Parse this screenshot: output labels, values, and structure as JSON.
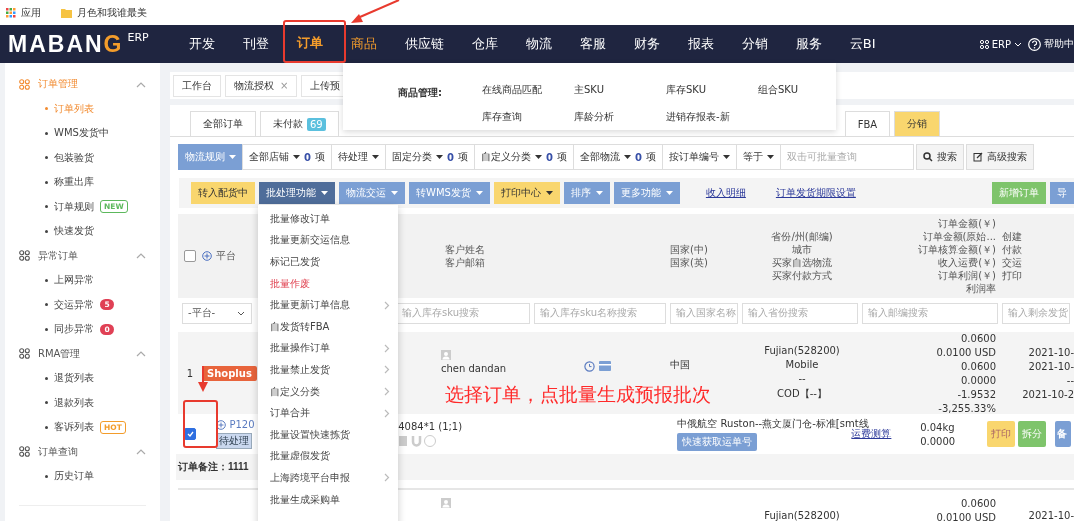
{
  "bookmarks": [
    {
      "kind": "apps",
      "label": "应用"
    },
    {
      "kind": "folder",
      "label": "月色和我谁最美"
    }
  ],
  "nav": {
    "logo": "MABANG",
    "logo_suffix": "ERP",
    "items": [
      {
        "label": "开发",
        "selected": false,
        "open": false
      },
      {
        "label": "刊登",
        "selected": false,
        "open": false
      },
      {
        "label": "订单",
        "selected": true,
        "open": false
      },
      {
        "label": "商品",
        "selected": false,
        "open": true
      },
      {
        "label": "供应链",
        "selected": false,
        "open": false
      },
      {
        "label": "仓库",
        "selected": false,
        "open": false
      },
      {
        "label": "物流",
        "selected": false,
        "open": false
      },
      {
        "label": "客服",
        "selected": false,
        "open": false
      },
      {
        "label": "财务",
        "selected": false,
        "open": false
      },
      {
        "label": "报表",
        "selected": false,
        "open": false
      },
      {
        "label": "分销",
        "selected": false,
        "open": false
      },
      {
        "label": "服务",
        "selected": false,
        "open": false
      },
      {
        "label": "云BI",
        "selected": false,
        "open": false
      }
    ],
    "erp": "ERP",
    "help": "帮助中"
  },
  "sidebar": {
    "groups": [
      {
        "label": "订单管理",
        "selected": true,
        "expanded": true,
        "children": [
          {
            "label": "订单列表",
            "selected": true
          },
          {
            "label": "WMS发货中",
            "selected": false
          },
          {
            "label": "包装验货",
            "selected": false
          },
          {
            "label": "称重出库",
            "selected": false
          },
          {
            "label": "订单规则",
            "selected": false,
            "badge": {
              "kind": "new",
              "text": "NEW"
            }
          },
          {
            "label": "快速发货",
            "selected": false
          }
        ]
      },
      {
        "label": "异常订单",
        "selected": false,
        "expanded": true,
        "children": [
          {
            "label": "上网异常",
            "selected": false
          },
          {
            "label": "交运异常",
            "selected": false,
            "badge": {
              "kind": "count",
              "text": "5"
            }
          },
          {
            "label": "同步异常",
            "selected": false,
            "badge": {
              "kind": "count",
              "text": "0"
            }
          }
        ]
      },
      {
        "label": "RMA管理",
        "selected": false,
        "expanded": true,
        "children": [
          {
            "label": "退货列表",
            "selected": false
          },
          {
            "label": "退款列表",
            "selected": false
          },
          {
            "label": "客诉列表",
            "selected": false,
            "badge": {
              "kind": "hot",
              "text": "HOT"
            }
          }
        ]
      },
      {
        "label": "订单查询",
        "selected": false,
        "expanded": true,
        "children": [
          {
            "label": "历史订单",
            "selected": false
          }
        ]
      }
    ]
  },
  "page_tabs": [
    {
      "label": "工作台"
    },
    {
      "label": "物流授权",
      "close": "×"
    },
    {
      "label": "上传预"
    }
  ],
  "mega_menu": {
    "title": "商品管理:",
    "rows": [
      [
        "在线商品匹配",
        "主SKU",
        "库存SKU",
        "组合SKU"
      ],
      [
        "库存查询",
        "库龄分析",
        "进销存报表-新"
      ]
    ]
  },
  "status_tabs": [
    {
      "label": "全部订单",
      "selected": false
    },
    {
      "label": "未付款",
      "count": "69",
      "selected": false
    },
    {
      "label": "FBA",
      "selected": false
    },
    {
      "label": "分销",
      "selected": true
    }
  ],
  "filters": [
    {
      "kind": "primary",
      "label": "物流规则"
    },
    {
      "kind": "select",
      "label": "全部店铺",
      "count": "0",
      "unit": "项"
    },
    {
      "kind": "select",
      "label": "待处理"
    },
    {
      "kind": "select",
      "label": "固定分类",
      "count": "0",
      "unit": "项"
    },
    {
      "kind": "select",
      "label": "自定义分类",
      "count": "0",
      "unit": "项"
    },
    {
      "kind": "select",
      "label": "全部物流",
      "count": "0",
      "unit": "项"
    },
    {
      "kind": "select",
      "label": "按订单编号"
    },
    {
      "kind": "select",
      "label": "等于"
    },
    {
      "kind": "input",
      "placeholder": "双击可批量查询"
    },
    {
      "kind": "search",
      "label": "搜索"
    },
    {
      "kind": "advanced",
      "label": "高级搜索"
    }
  ],
  "actions": [
    {
      "kind": "warning",
      "label": "转入配货中",
      "dropdown": false
    },
    {
      "kind": "dark",
      "label": "批处理功能",
      "dropdown": true
    },
    {
      "kind": "info",
      "label": "物流交运",
      "dropdown": true
    },
    {
      "kind": "info",
      "label": "转WMS发货",
      "dropdown": true
    },
    {
      "kind": "warning",
      "label": "打印中心",
      "dropdown": true
    },
    {
      "kind": "info",
      "label": "排序",
      "dropdown": true
    },
    {
      "kind": "info",
      "label": "更多功能",
      "dropdown": true
    },
    {
      "kind": "link",
      "label": "收入明细",
      "dropdown": false
    },
    {
      "kind": "link",
      "label": "订单发货期限设置",
      "dropdown": false
    },
    {
      "kind": "success",
      "label": "新增订单",
      "dropdown": false
    },
    {
      "kind": "info",
      "label": "导",
      "dropdown": false
    }
  ],
  "batch_menu": [
    {
      "label": "批量修改订单",
      "danger": false,
      "submenu": false
    },
    {
      "label": "批量更新交运信息",
      "danger": false,
      "submenu": false
    },
    {
      "label": "标记已发货",
      "danger": false,
      "submenu": false
    },
    {
      "label": "批量作废",
      "danger": true,
      "submenu": false
    },
    {
      "label": "批量更新订单信息",
      "danger": false,
      "submenu": true
    },
    {
      "label": "自发货转FBA",
      "danger": false,
      "submenu": false
    },
    {
      "label": "批量操作订单",
      "danger": false,
      "submenu": true
    },
    {
      "label": "批量禁止发货",
      "danger": false,
      "submenu": true
    },
    {
      "label": "自定义分类",
      "danger": false,
      "submenu": true
    },
    {
      "label": "订单合并",
      "danger": false,
      "submenu": true
    },
    {
      "label": "批量设置快速拣货",
      "danger": false,
      "submenu": false
    },
    {
      "label": "批量虚假发货",
      "danger": false,
      "submenu": false
    },
    {
      "label": "上海跨境平台申报",
      "danger": false,
      "submenu": true
    },
    {
      "label": "批量生成采购单",
      "danger": false,
      "submenu": false
    }
  ],
  "table": {
    "select_all": {
      "checked": false
    },
    "platform": "平台",
    "customer": [
      "客户姓名",
      "客户邮箱"
    ],
    "country": [
      "国家(中)",
      "国家(英)"
    ],
    "province": [
      "省份/州(邮编)",
      "城市",
      "买家自选物流",
      "买家付款方式"
    ],
    "amount": [
      "订单金额(￥)",
      "订单金额(原始...",
      "订单核算金额(￥)",
      "收入运费(￥)",
      "订单利润(￥)",
      "利润率"
    ],
    "dates": [
      "创建",
      "付款",
      "交运",
      "打印"
    ],
    "filters": {
      "platform": "-平台-",
      "inputs": [
        "输入库存sku搜索",
        "输入库存sku名称搜索",
        "输入国家名称",
        "输入省份搜索",
        "输入邮编搜索",
        "输入剩余发货"
      ]
    },
    "orders": [
      {
        "index": "1",
        "platform": "Shoplus",
        "customer": "chen dandan",
        "country": "中国",
        "province": [
          "Fujian(528200)",
          "Mobile",
          "--",
          "COD【--】"
        ],
        "amounts": [
          "0.0600",
          "0.0100 USD",
          "0.0600",
          "0.0000",
          "-1.9532",
          "-3,255.33%"
        ],
        "dates": [
          "2021-10-",
          "2021-10-",
          "--",
          "2021-10-2"
        ],
        "checked": true,
        "order_no": "P120",
        "status": "待处理",
        "sku": "4084*1  (1;1)",
        "shipping": "中俄航空 Ruston--燕文厦门仓-标准[smt线",
        "fetch": "快速获取运单号",
        "estimate": "运费测算",
        "weight": [
          "0.04kg",
          "0.0000"
        ],
        "buttons": [
          {
            "kind": "print",
            "label": "打印"
          },
          {
            "kind": "split",
            "label": "拆分"
          },
          {
            "kind": "note",
            "label": "备"
          }
        ],
        "note": "订单备注：1111"
      },
      {
        "province": [
          "Fujian(528200)"
        ],
        "amounts": [
          "0.0600",
          "0.0100 USD"
        ],
        "dates": [
          "2021-10-"
        ]
      }
    ]
  },
  "annotation": {
    "text": "选择订单，点批量生成预报批次"
  }
}
